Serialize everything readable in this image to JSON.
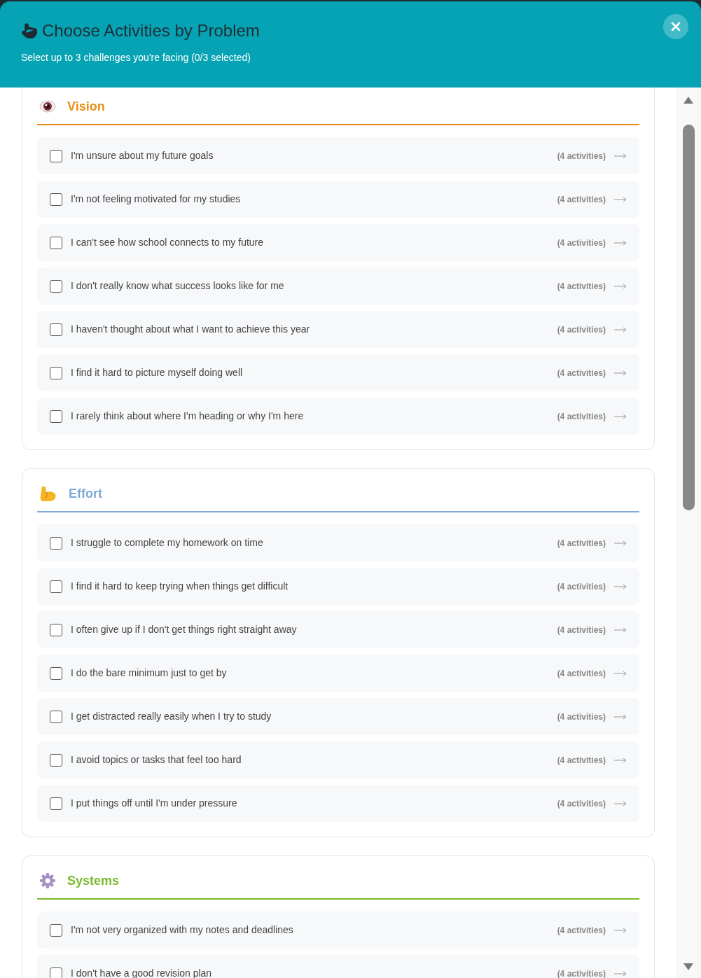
{
  "dialog": {
    "title": "Choose Activities by Problem",
    "subtitle": "Select up to 3 challenges you're facing (0/3 selected)"
  },
  "sections": [
    {
      "kind": "vision",
      "title": "Vision",
      "color": "#e8901a",
      "items": [
        {
          "text": "I'm unsure about my future goals",
          "count": "(4 activities)",
          "checked": false
        },
        {
          "text": "I'm not feeling motivated for my studies",
          "count": "(4 activities)",
          "checked": false
        },
        {
          "text": "I can't see how school connects to my future",
          "count": "(4 activities)",
          "checked": false
        },
        {
          "text": "I don't really know what success looks like for me",
          "count": "(4 activities)",
          "checked": false
        },
        {
          "text": "I haven't thought about what I want to achieve this year",
          "count": "(4 activities)",
          "checked": false
        },
        {
          "text": "I find it hard to picture myself doing well",
          "count": "(4 activities)",
          "checked": false
        },
        {
          "text": "I rarely think about where I'm heading or why I'm here",
          "count": "(4 activities)",
          "checked": false
        }
      ]
    },
    {
      "kind": "effort",
      "title": "Effort",
      "color": "#7fa8d8",
      "items": [
        {
          "text": "I struggle to complete my homework on time",
          "count": "(4 activities)",
          "checked": false
        },
        {
          "text": "I find it hard to keep trying when things get difficult",
          "count": "(4 activities)",
          "checked": false
        },
        {
          "text": "I often give up if I don't get things right straight away",
          "count": "(4 activities)",
          "checked": false
        },
        {
          "text": "I do the bare minimum just to get by",
          "count": "(4 activities)",
          "checked": false
        },
        {
          "text": "I get distracted really easily when I try to study",
          "count": "(4 activities)",
          "checked": false
        },
        {
          "text": "I avoid topics or tasks that feel too hard",
          "count": "(4 activities)",
          "checked": false
        },
        {
          "text": "I put things off until I'm under pressure",
          "count": "(4 activities)",
          "checked": false
        }
      ]
    },
    {
      "kind": "systems",
      "title": "Systems",
      "color": "#7cb82f",
      "items": [
        {
          "text": "I'm not very organized with my notes and deadlines",
          "count": "(4 activities)",
          "checked": false
        },
        {
          "text": "I don't have a good revision plan",
          "count": "(4 activities)",
          "checked": false
        }
      ]
    }
  ]
}
